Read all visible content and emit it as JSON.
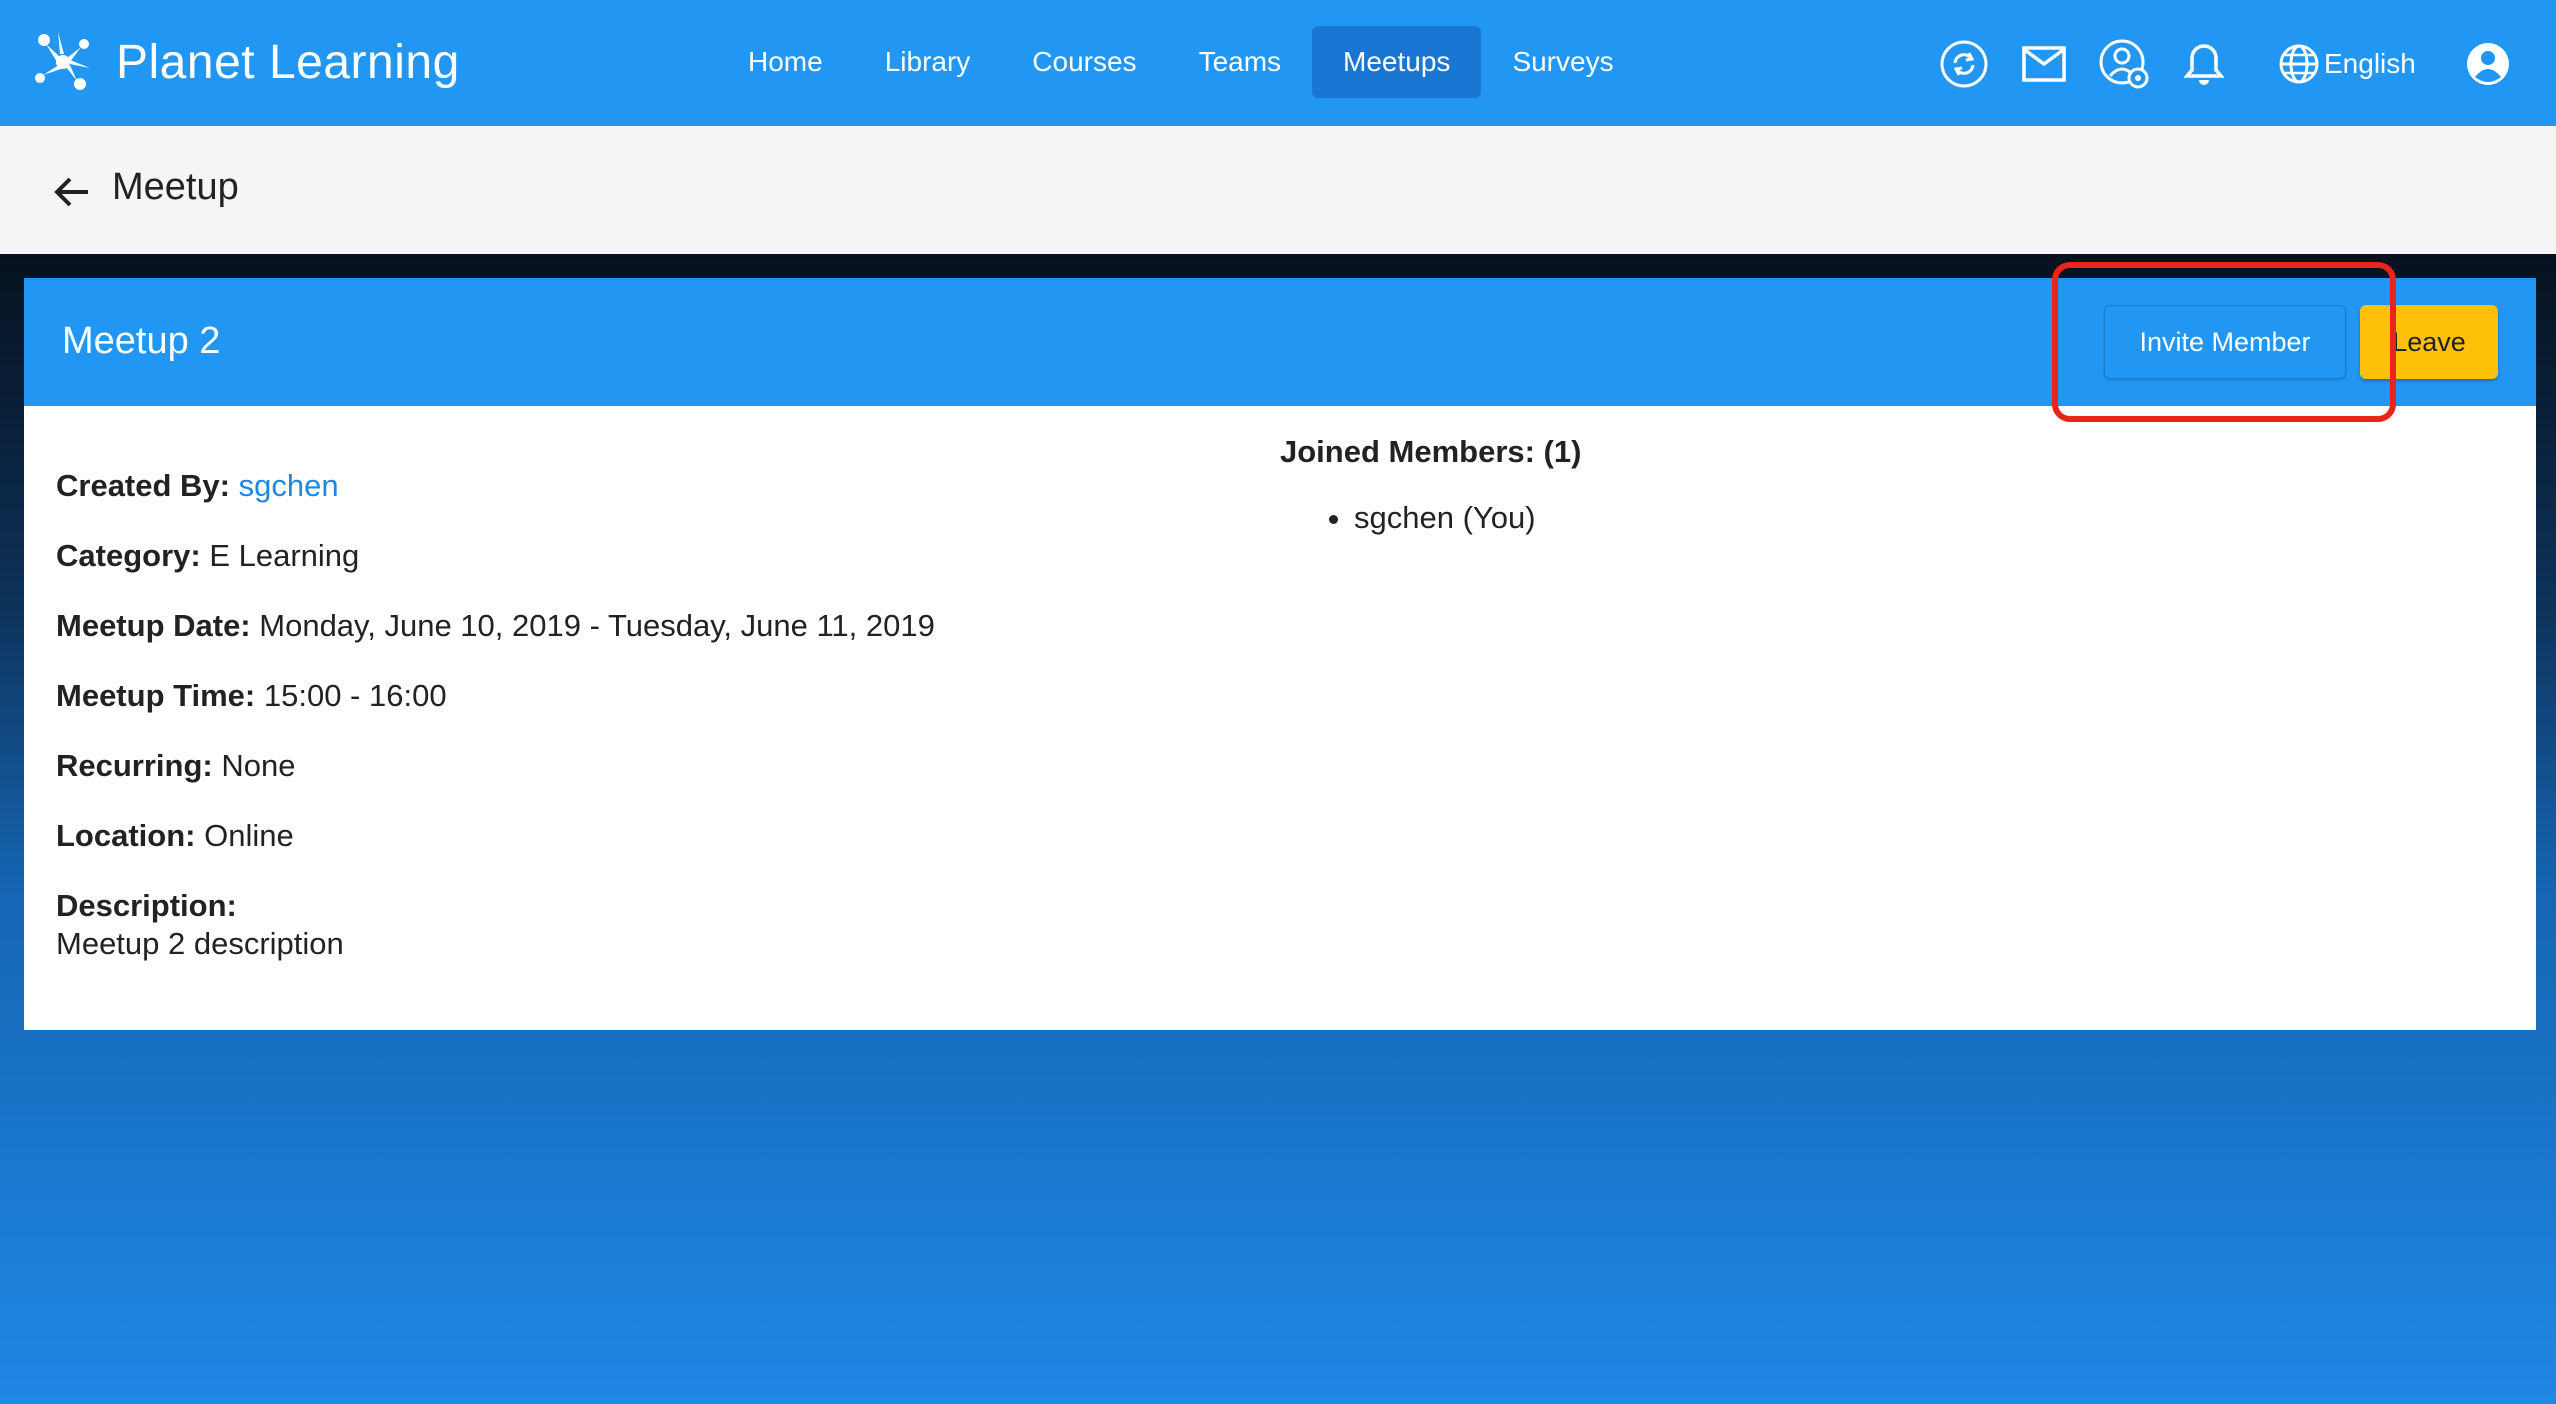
{
  "app": {
    "title": "Planet Learning",
    "logo_icon": "planet-logo-icon"
  },
  "nav": {
    "items": [
      {
        "label": "Home",
        "active": false
      },
      {
        "label": "Library",
        "active": false
      },
      {
        "label": "Courses",
        "active": false
      },
      {
        "label": "Teams",
        "active": false
      },
      {
        "label": "Meetups",
        "active": true
      },
      {
        "label": "Surveys",
        "active": false
      }
    ]
  },
  "toolbar": {
    "sync_icon": "sync-icon",
    "mail_icon": "mail-icon",
    "manager_icon": "user-settings-icon",
    "notifications_icon": "bell-icon",
    "language": "English",
    "account_icon": "account-circle-icon"
  },
  "page": {
    "title": "Meetup"
  },
  "meetup": {
    "name": "Meetup 2",
    "invite_label": "Invite Member",
    "leave_label": "Leave",
    "created_by_label": "Created By:",
    "created_by": "sgchen",
    "category_label": "Category:",
    "category": "E Learning",
    "date_label": "Meetup Date:",
    "date": "Monday, June 10, 2019 - Tuesday, June 11, 2019",
    "time_label": "Meetup Time:",
    "time": "15:00 - 16:00",
    "recurring_label": "Recurring:",
    "recurring": "None",
    "location_label": "Location:",
    "location": "Online",
    "description_label": "Description:",
    "description": "Meetup 2 description"
  },
  "members": {
    "title": "Joined Members: (1)",
    "list": [
      "sgchen (You)"
    ]
  },
  "colors": {
    "primary": "#2196f3",
    "active_nav": "#1976d2",
    "accent": "#ffc107",
    "highlight": "#e8251a"
  }
}
